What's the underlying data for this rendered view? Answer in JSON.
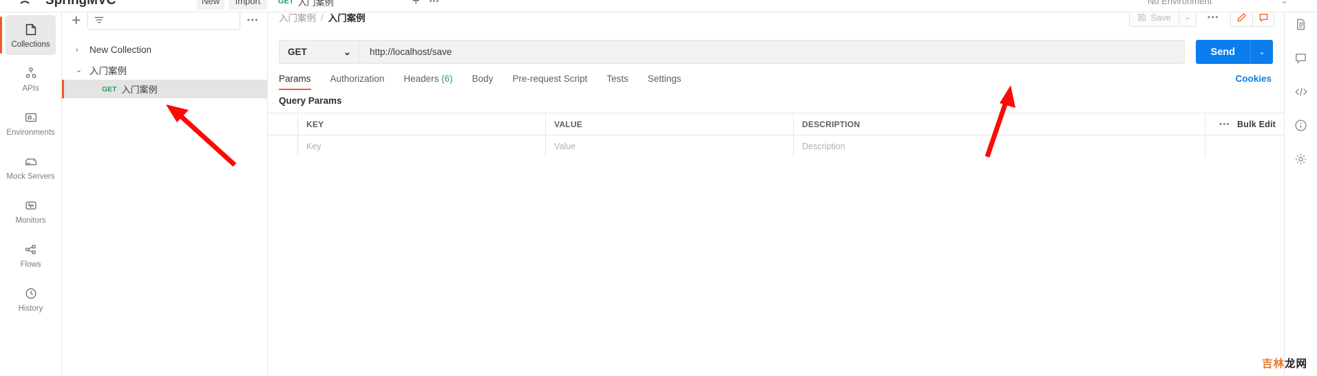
{
  "app": {
    "workspace_name": "SpringMVC",
    "new_button": "New",
    "import_button": "Import",
    "open_tab": {
      "method": "GET",
      "title": "入门案例"
    },
    "environment_selector": "No Environment"
  },
  "left_rail": {
    "items": [
      {
        "label": "Collections",
        "icon": "collections-icon",
        "active": true
      },
      {
        "label": "APIs",
        "icon": "apis-icon",
        "active": false
      },
      {
        "label": "Environments",
        "icon": "environments-icon",
        "active": false
      },
      {
        "label": "Mock Servers",
        "icon": "mock-servers-icon",
        "active": false
      },
      {
        "label": "Monitors",
        "icon": "monitors-icon",
        "active": false
      },
      {
        "label": "Flows",
        "icon": "flows-icon",
        "active": false
      },
      {
        "label": "History",
        "icon": "history-icon",
        "active": false
      }
    ]
  },
  "sidebar": {
    "filter_placeholder": "",
    "tree": [
      {
        "label": "New Collection",
        "expanded": false,
        "chevron": "›"
      },
      {
        "label": "入门案例",
        "expanded": true,
        "chevron": "⌄"
      }
    ],
    "request": {
      "method": "GET",
      "label": "入门案例",
      "selected": true
    }
  },
  "breadcrumb": {
    "parent": "入门案例",
    "separator": "/",
    "current": "入门案例"
  },
  "header_actions": {
    "save_label": "Save",
    "save_caret": "⌄",
    "more_dots": "•••",
    "edit_icon": "pencil-icon",
    "comment_icon": "comment-icon"
  },
  "request": {
    "method": "GET",
    "method_caret": "⌄",
    "url": "http://localhost/save",
    "send_label": "Send",
    "send_caret": "⌄"
  },
  "request_tabs": [
    {
      "label": "Params",
      "active": true
    },
    {
      "label": "Authorization",
      "active": false
    },
    {
      "label": "Headers",
      "count": "(6)",
      "active": false
    },
    {
      "label": "Body",
      "active": false
    },
    {
      "label": "Pre-request Script",
      "active": false
    },
    {
      "label": "Tests",
      "active": false
    },
    {
      "label": "Settings",
      "active": false
    }
  ],
  "cookies_link": "Cookies",
  "query_params": {
    "section_title": "Query Params",
    "columns": [
      "KEY",
      "VALUE",
      "DESCRIPTION"
    ],
    "rows": [
      {
        "key": "Key",
        "value": "Value",
        "description": "Description"
      }
    ],
    "row_dots": "•••",
    "bulk_edit": "Bulk Edit"
  },
  "right_rail": {
    "icons": [
      "document-icon",
      "comment-icon",
      "code-icon",
      "info-icon",
      "settings-icon"
    ]
  },
  "watermark": {
    "orange": "吉林",
    "black": "龙网"
  },
  "colors": {
    "accent_orange": "#ef5b25",
    "send_blue": "#0b7ded",
    "get_green": "#2d9d58",
    "arrow_red": "#fb0a06"
  }
}
